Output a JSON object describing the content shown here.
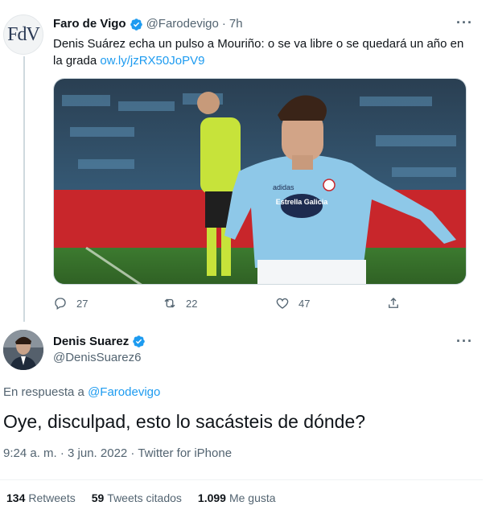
{
  "parent_tweet": {
    "avatar_text": "FdV",
    "author_name": "Faro de Vigo",
    "handle": "@Farodevigo",
    "separator": "·",
    "time": "7h",
    "text": "Denis Suárez echa un pulso a Mouriño: o se va libre o se quedará un año en la grada ",
    "link": "ow.ly/jzRX50JoPV9",
    "media_sponsor_text": "Estrella Galicia",
    "media_brand_text": "adidas",
    "replies": "27",
    "retweets": "22",
    "likes": "47"
  },
  "main_tweet": {
    "author_name": "Denis Suarez",
    "handle": "@DenisSuarez6",
    "reply_prefix": "En respuesta a ",
    "reply_handle": "@Farodevigo",
    "text": "Oye, disculpad, esto lo sacásteis de dónde?",
    "meta": "9:24 a. m. · 3 jun. 2022 · Twitter for iPhone",
    "retweets_count": "134",
    "retweets_label": "Retweets",
    "quotes_count": "59",
    "quotes_label": "Tweets citados",
    "likes_count": "1.099",
    "likes_label": "Me gusta"
  },
  "colors": {
    "accent": "#1d9bf0",
    "secondary_text": "#536471",
    "jersey": "#8ec8e8"
  },
  "icons": [
    "verified-badge-icon",
    "more-icon",
    "reply-icon",
    "retweet-icon",
    "like-icon",
    "share-icon"
  ]
}
